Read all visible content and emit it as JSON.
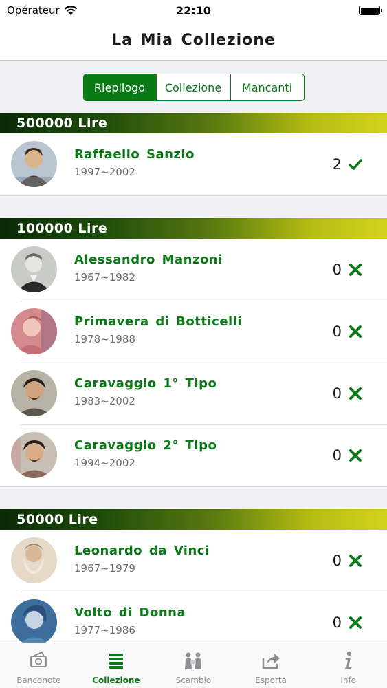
{
  "status_bar": {
    "carrier": "Opérateur",
    "time": "22:10"
  },
  "nav": {
    "title": "La Mia Collezione"
  },
  "segments": [
    {
      "label": "Riepilogo",
      "active": true
    },
    {
      "label": "Collezione",
      "active": false
    },
    {
      "label": "Mancanti",
      "active": false
    }
  ],
  "sections": [
    {
      "title": "500000 Lire",
      "items": [
        {
          "name": "Raffaello Sanzio",
          "years": "1997~2002",
          "count": "2",
          "owned": true
        }
      ]
    },
    {
      "title": "100000 Lire",
      "items": [
        {
          "name": "Alessandro Manzoni",
          "years": "1967~1982",
          "count": "0",
          "owned": false
        },
        {
          "name": "Primavera di Botticelli",
          "years": "1978~1988",
          "count": "0",
          "owned": false
        },
        {
          "name": "Caravaggio 1° Tipo",
          "years": "1983~2002",
          "count": "0",
          "owned": false
        },
        {
          "name": "Caravaggio 2° Tipo",
          "years": "1994~2002",
          "count": "0",
          "owned": false
        }
      ]
    },
    {
      "title": "50000 Lire",
      "items": [
        {
          "name": "Leonardo da Vinci",
          "years": "1967~1979",
          "count": "0",
          "owned": false
        },
        {
          "name": "Volto di Donna",
          "years": "1977~1986",
          "count": "0",
          "owned": false
        }
      ]
    }
  ],
  "tabs": [
    {
      "label": "Banconote",
      "icon": "banknote-icon",
      "active": false
    },
    {
      "label": "Collezione",
      "icon": "collection-stack-icon",
      "active": true
    },
    {
      "label": "Scambio",
      "icon": "exchange-people-icon",
      "active": false
    },
    {
      "label": "Esporta",
      "icon": "share-export-icon",
      "active": false
    },
    {
      "label": "Info",
      "icon": "info-icon",
      "active": false
    }
  ],
  "colors": {
    "accent": "#0a7a17",
    "header_dark": "#0b2a06",
    "header_light": "#d4d21c",
    "background": "#efeff4"
  }
}
